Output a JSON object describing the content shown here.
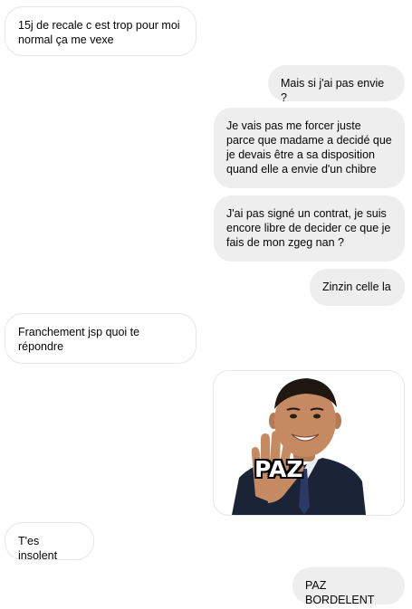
{
  "conversation": {
    "messages": [
      {
        "id": "m1",
        "side": "incoming",
        "text": "15j de recale c est trop pour moi normal ça me vexe"
      },
      {
        "id": "m2",
        "side": "outgoing",
        "text": "Mais si j'ai pas envie ?"
      },
      {
        "id": "m3",
        "side": "outgoing",
        "text": "Je vais pas me forcer juste parce que madame a decidé que je devais être a sa disposition quand elle a envie d'un chibre"
      },
      {
        "id": "m4",
        "side": "outgoing",
        "text": "J'ai pas signé un contrat, je suis encore libre de decider ce que je fais de mon zgeg nan ?"
      },
      {
        "id": "m5",
        "side": "outgoing",
        "text": "Zinzin celle la"
      },
      {
        "id": "m6",
        "side": "incoming",
        "text": "Franchement jsp quoi te répondre"
      },
      {
        "id": "m7",
        "side": "outgoing",
        "type": "sticker",
        "sticker_text": "PAZ"
      },
      {
        "id": "m8",
        "side": "incoming",
        "text": "T'es insolent"
      },
      {
        "id": "m9",
        "side": "outgoing",
        "text": "PAZ BORDELENT"
      }
    ]
  },
  "colors": {
    "incoming_bubble_bg": "#ffffff",
    "incoming_bubble_border": "#e4e6eb",
    "outgoing_bubble_bg": "#eeeeee",
    "text": "#050505"
  }
}
